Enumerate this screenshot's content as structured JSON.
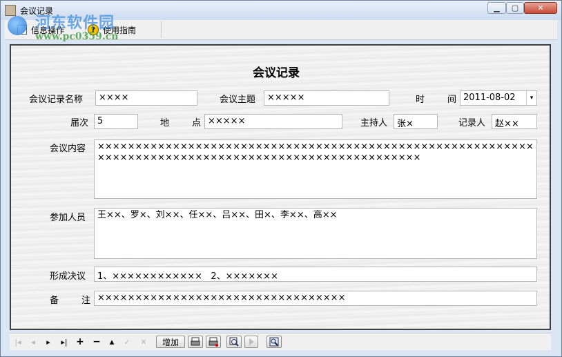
{
  "window": {
    "title": "会议记录",
    "min_glyph": "▁",
    "max_glyph": "▢",
    "close_glyph": "✕"
  },
  "watermark": {
    "line1": "河东软件园",
    "line2": "www.pc0359.cn"
  },
  "toolbar": {
    "items": [
      {
        "label": "信息操作",
        "icon": "document-icon"
      },
      {
        "label": "使用指南",
        "icon": "help-icon",
        "glyph": "?"
      }
    ]
  },
  "form": {
    "title": "会议记录",
    "labels": {
      "record_name": "会议记录名称",
      "topic": "会议主题",
      "time_a": "时",
      "time_b": "间",
      "session": "届次",
      "location_a": "地",
      "location_b": "点",
      "host": "主持人",
      "recorder": "记录人",
      "content": "会议内容",
      "participants": "参加人员",
      "resolution": "形成决议",
      "remark_a": "备",
      "remark_b": "注"
    },
    "values": {
      "record_name": "××××",
      "topic": "×××××",
      "time": "2011-08-02",
      "session": "5",
      "location": "×××××",
      "host": "张×",
      "recorder": "赵××",
      "content": "×××××××××××××××××××××××××××××××××××××××××××××××××××××××××××××××××××××××××××××××××××××××××××××××××××××",
      "participants": "王××、罗×、刘××、任××、吕××、田×、李××、高××",
      "resolution": "1、××××××××××××   2、×××××××",
      "remark": "×××××××××××××××××××××××××××××××××"
    },
    "time_dropdown_glyph": "▾"
  },
  "navbar": {
    "first": "|◂",
    "prev": "◂",
    "next": "▸",
    "last": "▸|",
    "add": "+",
    "delete": "−",
    "up": "▴",
    "save": "✓",
    "cancel": "✕",
    "add_button": "增加",
    "print_icon": "printer-icon",
    "print_preview_icon": "printer-preview-icon",
    "zoom_icon": "magnifier-icon",
    "play_icon": "play-icon",
    "search_icon": "search-icon"
  }
}
